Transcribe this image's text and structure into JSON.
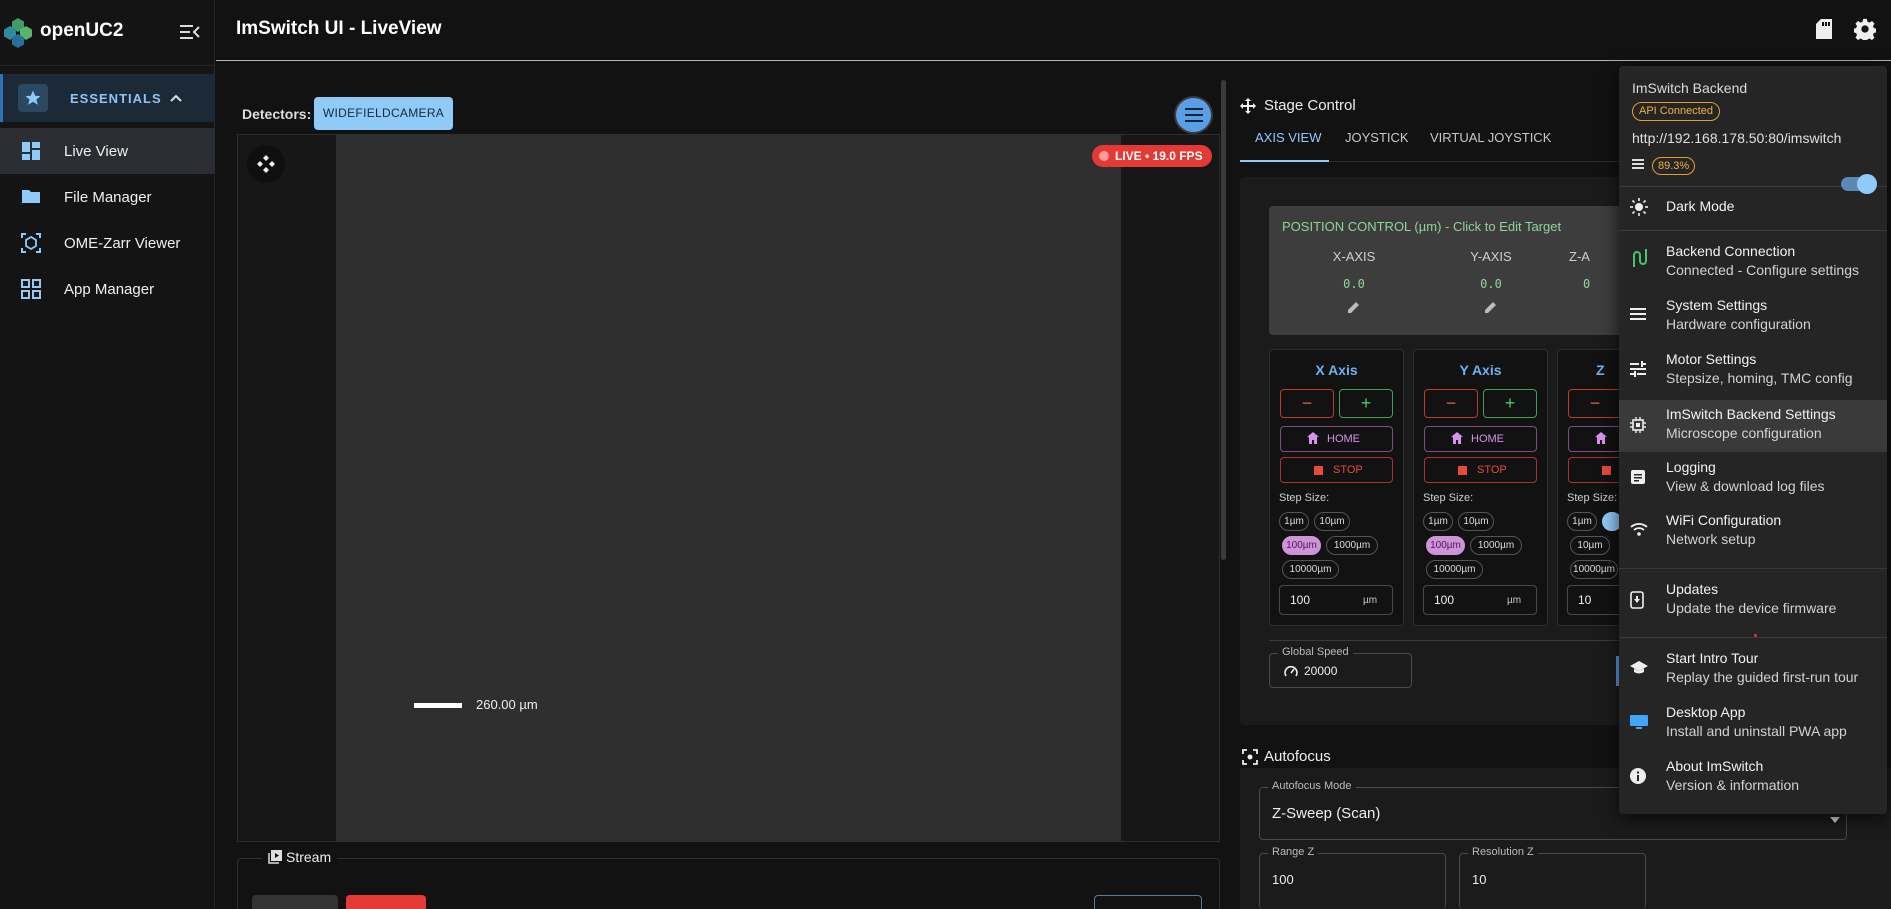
{
  "app": {
    "name": "openUC2",
    "title": "ImSwitch UI - LiveView"
  },
  "sidebar": {
    "section": "ESSENTIALS",
    "items": [
      {
        "label": "Live View"
      },
      {
        "label": "File Manager"
      },
      {
        "label": "OME-Zarr Viewer"
      },
      {
        "label": "App Manager"
      }
    ]
  },
  "camera": {
    "detectors_label": "Detectors:",
    "detector_button": "WIDEFIELDCAMERA",
    "live_badge": "LIVE • 19.0 FPS",
    "scale_text": "260.00 µm",
    "stream_label": "Stream"
  },
  "stage": {
    "title": "Stage Control",
    "tabs": [
      "AXIS VIEW",
      "JOYSTICK",
      "VIRTUAL JOYSTICK"
    ],
    "position_title": "POSITION CONTROL (µm) - Click to Edit Target",
    "axes_positions": [
      {
        "name": "X-AXIS",
        "value": "0.0"
      },
      {
        "name": "Y-AXIS",
        "value": "0.0"
      },
      {
        "name": "Z-A",
        "value": "0"
      }
    ],
    "axis_cards": [
      {
        "title": "X Axis",
        "step": "100",
        "chips": [
          "1µm",
          "10µm",
          "100µm",
          "1000µm",
          "10000µm"
        ]
      },
      {
        "title": "Y Axis",
        "step": "100",
        "chips": [
          "1µm",
          "10µm",
          "100µm",
          "1000µm",
          "10000µm"
        ]
      },
      {
        "title": "Z",
        "step": "10",
        "chips": [
          "1µm",
          "",
          "10µm",
          "10000µm"
        ]
      }
    ],
    "minus": "−",
    "plus": "+",
    "home": "HOME",
    "stop": "STOP",
    "step_size": "Step Size:",
    "unit": "µm",
    "global_speed_label": "Global Speed",
    "global_speed": "20000"
  },
  "autofocus": {
    "title": "Autofocus",
    "mode_label": "Autofocus Mode",
    "mode": "Z-Sweep (Scan)",
    "range_label": "Range Z",
    "range": "100",
    "resolution_label": "Resolution Z",
    "resolution": "10"
  },
  "menu": {
    "backend_title": "ImSwitch Backend",
    "api_status": "API Connected",
    "url": "http://192.168.178.50:80/imswitch",
    "memory": "89.3%",
    "dark_mode": "Dark Mode",
    "items": [
      {
        "title": "Backend Connection",
        "sub": "Connected - Configure settings",
        "icon": "cable-icon"
      },
      {
        "title": "System Settings",
        "sub": "Hardware configuration",
        "icon": "list-icon"
      },
      {
        "title": "Motor Settings",
        "sub": "Stepsize, homing, TMC config",
        "icon": "tune-icon"
      },
      {
        "title": "ImSwitch Backend Settings",
        "sub": "Microscope configuration",
        "icon": "chip-icon"
      },
      {
        "title": "Logging",
        "sub": "View & download log files",
        "icon": "article-icon"
      },
      {
        "title": "WiFi Configuration",
        "sub": "Network setup",
        "icon": "wifi-icon"
      },
      {
        "title": "Updates",
        "sub": "Update the device firmware",
        "icon": "phone-update-icon"
      },
      {
        "title": "Start Intro Tour",
        "sub": "Replay the guided first-run tour",
        "icon": "school-icon"
      },
      {
        "title": "Desktop App",
        "sub": "Install and uninstall PWA app",
        "icon": "desktop-icon"
      },
      {
        "title": "About ImSwitch",
        "sub": "Version & information",
        "icon": "info-icon"
      }
    ]
  },
  "colors": {
    "accent": "#90caf9",
    "live": "#e53935",
    "highlight": "#ce93d8",
    "warning": "#f0b040"
  }
}
